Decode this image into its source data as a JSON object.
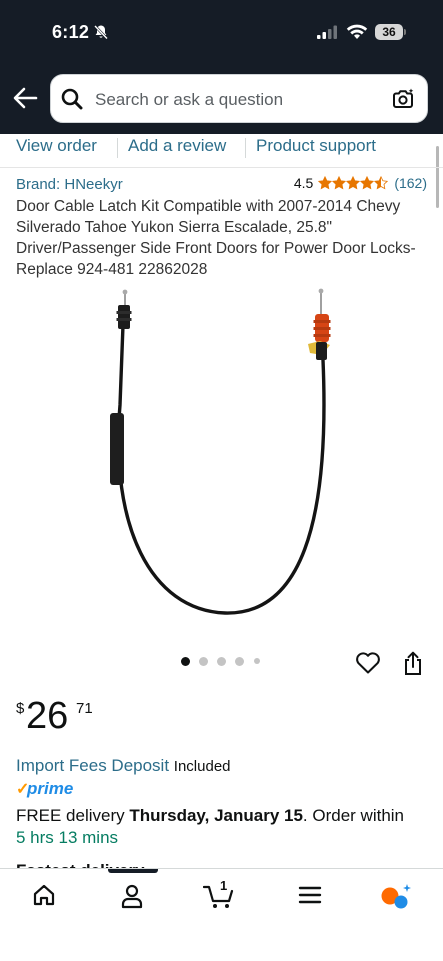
{
  "status_bar": {
    "time": "6:12",
    "battery": "36"
  },
  "search": {
    "placeholder": "Search or ask a question"
  },
  "action_links": {
    "view_order": "View order",
    "add_review": "Add a review",
    "product_support": "Product support"
  },
  "product": {
    "brand": "Brand: HNeekyr",
    "rating": "4.5",
    "review_count": "(162)",
    "title": "Door Cable Latch Kit Compatible with 2007-2014 Chevy Silverado Tahoe Yukon Sierra Escalade, 25.8\" Driver/Passenger Side Front Doors for Power Door Locks-Replace 924-481 22862028",
    "image_count": 5,
    "active_image": 1
  },
  "price": {
    "currency": "$",
    "whole": "26",
    "fraction": "71"
  },
  "fees": {
    "link": "Import Fees Deposit",
    "suffix": "Included"
  },
  "prime": {
    "check": "✓",
    "label": "prime"
  },
  "delivery": {
    "prefix": "FREE delivery",
    "date": "Thursday, January 15",
    "middle": ". Order within",
    "countdown": "5 hrs 13 mins",
    "next_line_partial": "Fastest delivery..."
  },
  "nav": {
    "cart_count": "1",
    "active": "account"
  },
  "colors": {
    "header_bg": "#151c26",
    "link": "#2c6d8a",
    "star": "#e77600",
    "green": "#067d62",
    "prime_blue": "#1f8ce6",
    "prime_check": "#ff9900"
  }
}
